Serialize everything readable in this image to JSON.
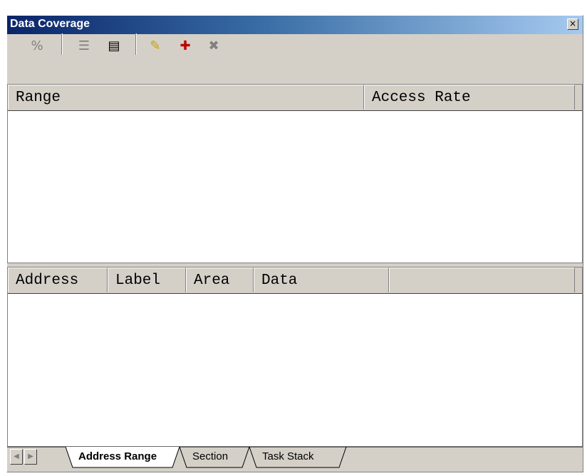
{
  "window": {
    "title": "Data Coverage",
    "close_glyph": "×"
  },
  "toolbar": {
    "items": [
      {
        "icon": "percent-icon",
        "glyph": "%"
      },
      {
        "icon": "select-icon",
        "glyph": "☰"
      },
      {
        "icon": "memory-icon",
        "glyph": "▤"
      },
      {
        "icon": "highlight-icon",
        "glyph": "✎"
      },
      {
        "icon": "add-range-icon",
        "glyph": "✚"
      },
      {
        "icon": "delete-range-icon",
        "glyph": "✖"
      }
    ]
  },
  "range_table": {
    "columns": [
      "Range",
      "Access Rate"
    ]
  },
  "address_table": {
    "columns": [
      "Address",
      "Label",
      "Area",
      "Data"
    ]
  },
  "tabs": [
    {
      "label": "Address Range",
      "active": true
    },
    {
      "label": "Section",
      "active": false
    },
    {
      "label": "Task Stack",
      "active": false
    }
  ]
}
